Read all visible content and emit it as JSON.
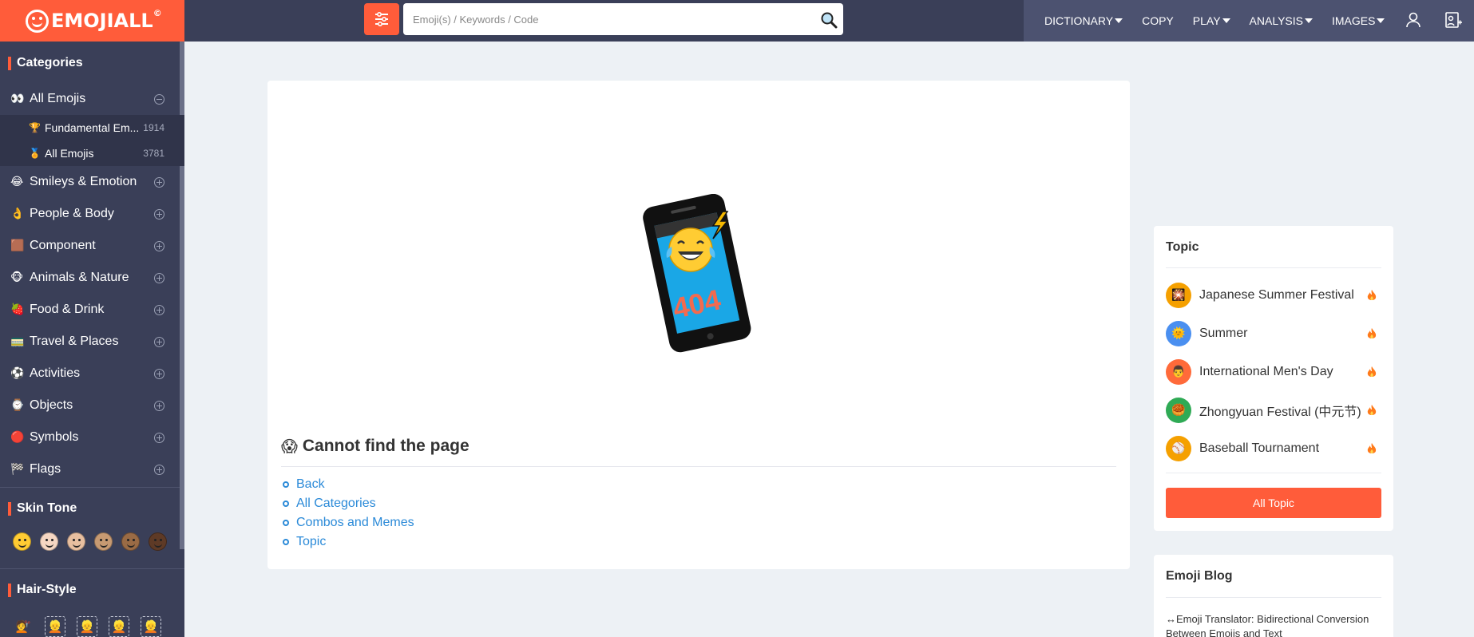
{
  "header": {
    "logo_text": "EMOJIALL",
    "logo_mark": "©",
    "search_placeholder": "Emoji(s) / Keywords / Code",
    "nav": [
      {
        "label": "DICTIONARY",
        "dropdown": true
      },
      {
        "label": "COPY",
        "dropdown": false
      },
      {
        "label": "PLAY",
        "dropdown": true
      },
      {
        "label": "ANALYSIS",
        "dropdown": true
      },
      {
        "label": "IMAGES",
        "dropdown": true
      }
    ],
    "icons": [
      "filter-icon",
      "search-icon",
      "user-icon",
      "add-image-icon"
    ]
  },
  "sidebar": {
    "categories_title": "Categories",
    "all_emojis": {
      "emoji": "👀",
      "label": "All Emojis"
    },
    "sub_items": [
      {
        "emoji": "🏆",
        "label": "Fundamental Em...",
        "count": "1914"
      },
      {
        "emoji": "🏅",
        "label": "All Emojis",
        "count": "3781"
      }
    ],
    "categories": [
      {
        "emoji": "😂",
        "label": "Smileys & Emotion"
      },
      {
        "emoji": "👌",
        "label": "People & Body"
      },
      {
        "emoji": "🟫",
        "label": "Component"
      },
      {
        "emoji": "🐵",
        "label": "Animals & Nature"
      },
      {
        "emoji": "🍓",
        "label": "Food & Drink"
      },
      {
        "emoji": "🚃",
        "label": "Travel & Places"
      },
      {
        "emoji": "⚽",
        "label": "Activities"
      },
      {
        "emoji": "⌚",
        "label": "Objects"
      },
      {
        "emoji": "🔴",
        "label": "Symbols"
      },
      {
        "emoji": "🏁",
        "label": "Flags"
      }
    ],
    "skin_tone_title": "Skin Tone",
    "skin_tones": [
      "#ffcc33",
      "#f6d7c3",
      "#e8bfa0",
      "#c79a72",
      "#9a6b45",
      "#5e3a26"
    ],
    "hair_style_title": "Hair-Style",
    "hair_styles": [
      "💇",
      "👱",
      "👱",
      "👱",
      "👱"
    ]
  },
  "main": {
    "illustration_text": "404",
    "error_emoji": "😱",
    "error_title": "Cannot find the page",
    "links": [
      "Back",
      "All Categories",
      "Combos and Memes",
      "Topic"
    ]
  },
  "topic_card": {
    "title": "Topic",
    "items": [
      {
        "emoji": "🎇",
        "label": "Japanese Summer Festival",
        "color": "#f5a000"
      },
      {
        "emoji": "🌞",
        "label": "Summer",
        "color": "#4a8ff0"
      },
      {
        "emoji": "👨",
        "label": "International Men's Day",
        "color": "#ff6a3a"
      },
      {
        "emoji": "🥮",
        "label": "Zhongyuan Festival (中元节)",
        "color": "#2faa55"
      },
      {
        "emoji": "⚾",
        "label": "Baseball Tournament",
        "color": "#f5a000"
      }
    ],
    "button_label": "All Topic"
  },
  "blog_card": {
    "title": "Emoji Blog",
    "text": "↔Emoji Translator: Bidirectional Conversion Between Emojis and Text"
  },
  "colors": {
    "accent": "#ff5c3a",
    "topbar": "#3a3f58",
    "link": "#2b8ad8",
    "background": "#edf1f5"
  }
}
